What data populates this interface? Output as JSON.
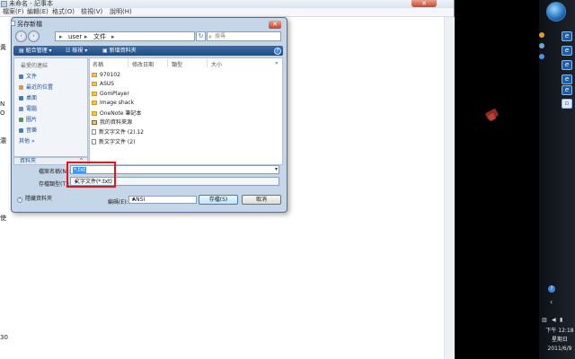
{
  "notepad": {
    "title": "未命名 - 記事本",
    "menu": [
      "檔案(F)",
      "編輯(E)",
      "格式(O)",
      "檢視(V)",
      "說明(H)"
    ],
    "close_glyph": "✕",
    "side_fragments": [
      "黃",
      "N",
      "O",
      "濃",
      "使",
      "30"
    ]
  },
  "dialog": {
    "title": "另存新檔",
    "close_glyph": "✕",
    "nav": {
      "back": "‹",
      "forward": "›",
      "path": [
        "user",
        "文件"
      ],
      "path_separator": "▸",
      "refresh": "↻",
      "search_placeholder": "搜尋"
    },
    "toolbar": {
      "organize": "組合管理",
      "views": "檢視",
      "new_folder": "新增資料夾",
      "help": "?"
    },
    "favorites": {
      "header": "最愛的連結",
      "items": [
        {
          "label": "文件",
          "color": "#4d7fc4"
        },
        {
          "label": "最近的位置",
          "color": "#c9a23c"
        },
        {
          "label": "桌面",
          "color": "#3a79c6"
        },
        {
          "label": "電腦",
          "color": "#6d8fb8"
        },
        {
          "label": "圖片",
          "color": "#4f9a55"
        },
        {
          "label": "音樂",
          "color": "#3f7fc9"
        },
        {
          "label": "其他",
          "color": "#4a4a4a"
        }
      ],
      "more": "»"
    },
    "folder_pane_label": "資料夾",
    "folder_pane_chevron": "^",
    "columns": [
      "名稱",
      "修改日期",
      "類型",
      "大小"
    ],
    "files": [
      {
        "name": "970102",
        "kind": "folder"
      },
      {
        "name": "ASUS",
        "kind": "folder"
      },
      {
        "name": "GomPlayer",
        "kind": "folder"
      },
      {
        "name": "Image shack",
        "kind": "folder"
      },
      {
        "name": "OneNote 筆記本",
        "kind": "folder"
      },
      {
        "name": "我的資料來源",
        "kind": "shared"
      },
      {
        "name": "新文字文件 (2).12",
        "kind": "txt"
      },
      {
        "name": "新文字文件 (2)",
        "kind": "txt"
      }
    ],
    "file_name_label": "檔案名稱(N):",
    "file_name_value": "*.txt",
    "save_type_label": "存檔類型(T):",
    "save_type_value": "文字文件(*.txt)",
    "hide_folders": "隱藏資料夾",
    "encoding_label": "編碼(E):",
    "encoding_value": "ANSI",
    "save_button": "存檔(S)",
    "cancel_button": "取消",
    "dropdown_glyph": "▾"
  },
  "taskbar": {
    "time": "下午 12:18",
    "day": "星期日",
    "date": "2011/6/9",
    "help": "?",
    "arrow": "‹"
  },
  "colors": {
    "dialog_bg": "#c5d6e8",
    "command_bar": "#1d4d86",
    "highlight_box": "#e0161b",
    "selection": "#3399ff"
  }
}
